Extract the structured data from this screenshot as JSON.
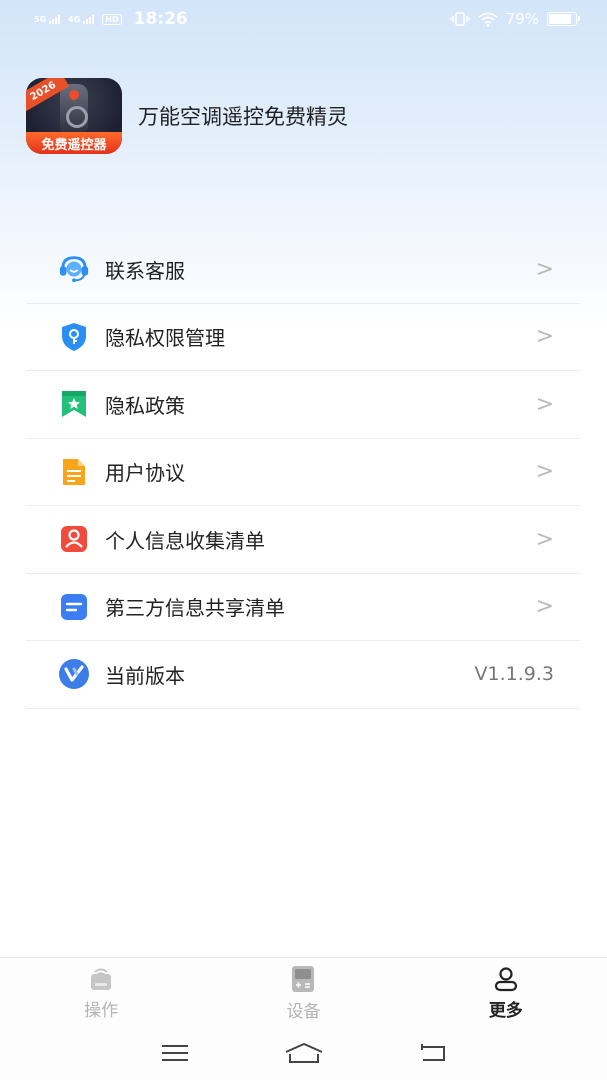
{
  "status_bar": {
    "signal1": "5G",
    "signal2": "4G",
    "hd": "HD",
    "time": "18:26",
    "battery_text": "79%",
    "battery_level": 0.79
  },
  "app": {
    "name": "万能空调遥控免费精灵",
    "logo_year": "2026",
    "logo_banner": "免费遥控器"
  },
  "menu": {
    "items": [
      {
        "label": "联系客服",
        "icon": "headset-icon"
      },
      {
        "label": "隐私权限管理",
        "icon": "shield-key-icon"
      },
      {
        "label": "隐私政策",
        "icon": "bookmark-star-icon"
      },
      {
        "label": "用户协议",
        "icon": "document-icon"
      },
      {
        "label": "个人信息收集清单",
        "icon": "person-icon"
      },
      {
        "label": "第三方信息共享清单",
        "icon": "list-icon"
      },
      {
        "label": "当前版本",
        "icon": "v-logo-icon",
        "value": "V1.1.9.3"
      }
    ],
    "chevron": ">"
  },
  "tabbar": {
    "tabs": [
      {
        "label": "操作",
        "icon": "remote-operate-icon",
        "active": false
      },
      {
        "label": "设备",
        "icon": "device-icon",
        "active": false
      },
      {
        "label": "更多",
        "icon": "user-icon",
        "active": true
      }
    ]
  },
  "colors": {
    "accent_blue": "#2f7fe6",
    "orange": "#f7a11a",
    "red": "#ec4b3c",
    "green": "#22b872",
    "inactive": "#b4b4b4"
  }
}
